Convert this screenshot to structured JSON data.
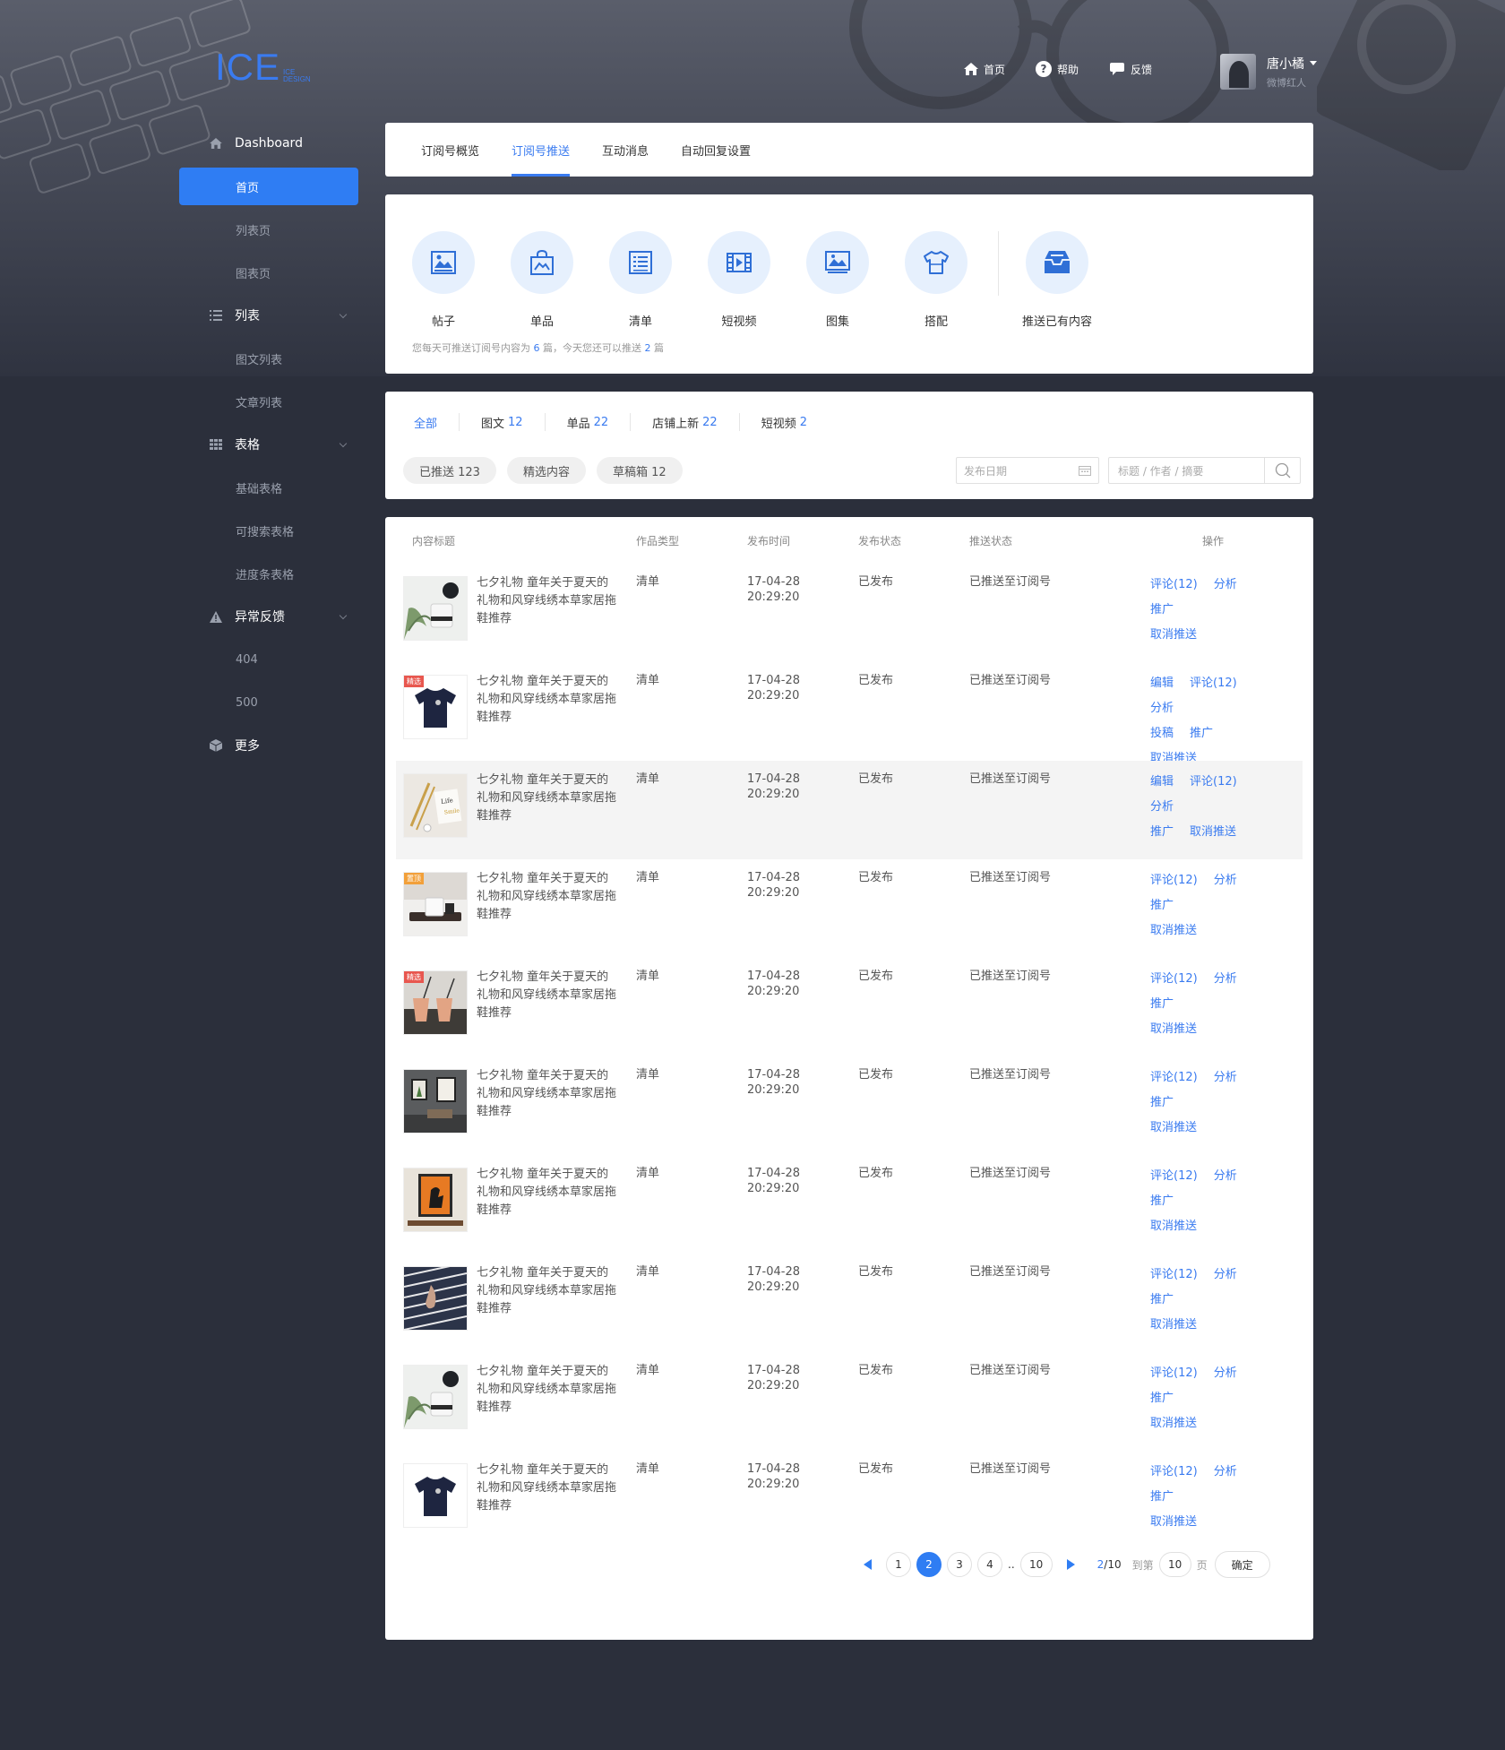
{
  "header": {
    "logo_main": "ICE",
    "logo_sub1": "ICE",
    "logo_sub2": "DESIGN",
    "nav": [
      {
        "label": "首页",
        "icon": "home-icon"
      },
      {
        "label": "帮助",
        "icon": "help-icon"
      },
      {
        "label": "反馈",
        "icon": "chat-icon"
      }
    ],
    "user": {
      "name": "唐小橘",
      "role": "微博红人"
    }
  },
  "sidebar": {
    "dashboard": "Dashboard",
    "dashboard_items": [
      "首页",
      "列表页",
      "图表页"
    ],
    "list": "列表",
    "list_items": [
      "图文列表",
      "文章列表"
    ],
    "table": "表格",
    "table_items": [
      "基础表格",
      "可搜索表格",
      "进度条表格"
    ],
    "error": "异常反馈",
    "error_items": [
      "404",
      "500"
    ],
    "more": "更多"
  },
  "tabs": [
    "订阅号概览",
    "订阅号推送",
    "互动消息",
    "自动回复设置"
  ],
  "active_tab": "订阅号推送",
  "push": {
    "items": [
      {
        "label": "帖子",
        "icon": "image-post-icon"
      },
      {
        "label": "单品",
        "icon": "shopping-bag-icon"
      },
      {
        "label": "清单",
        "icon": "list-icon"
      },
      {
        "label": "短视频",
        "icon": "video-icon"
      },
      {
        "label": "图集",
        "icon": "gallery-icon"
      },
      {
        "label": "搭配",
        "icon": "tshirt-icon"
      }
    ],
    "existing": {
      "label": "推送已有内容",
      "icon": "inbox-icon"
    },
    "note_pre": "您每天可推送订阅号内容为",
    "note_n1": "6",
    "note_mid": "篇，今天您还可以推送",
    "note_n2": "2",
    "note_post": "篇"
  },
  "filters": {
    "tabs": [
      {
        "label": "全部",
        "count": ""
      },
      {
        "label": "图文",
        "count": "12"
      },
      {
        "label": "单品",
        "count": "22"
      },
      {
        "label": "店铺上新",
        "count": "22"
      },
      {
        "label": "短视频",
        "count": "2"
      }
    ],
    "pills": [
      "已推送 123",
      "精选内容",
      "草稿箱 12"
    ],
    "date_placeholder": "发布日期",
    "search_placeholder": "标题 / 作者 / 摘要"
  },
  "table": {
    "headers": [
      "内容标题",
      "作品类型",
      "发布时间",
      "发布状态",
      "推送状态",
      "操作"
    ],
    "rows": [
      {
        "title": "七夕礼物 童年关于夏天的礼物和风穿线绣本草家居拖鞋推荐",
        "type": "清单",
        "date": "17-04-28",
        "time": "20:29:20",
        "status": "已发布",
        "push": "已推送至订阅号",
        "badge": "",
        "thumb": "candle",
        "ops": [
          [
            "评论(12)",
            "分析",
            "推广"
          ],
          [
            "取消推送"
          ]
        ]
      },
      {
        "title": "七夕礼物 童年关于夏天的礼物和风穿线绣本草家居拖鞋推荐",
        "type": "清单",
        "date": "17-04-28",
        "time": "20:29:20",
        "status": "已发布",
        "push": "已推送至订阅号",
        "badge": "精选",
        "badge_color": "red",
        "thumb": "tshirt",
        "ops": [
          [
            "编辑",
            "评论(12)",
            "分析"
          ],
          [
            "投稿",
            "推广",
            "取消推送"
          ]
        ]
      },
      {
        "title": "七夕礼物 童年关于夏天的礼物和风穿线绣本草家居拖鞋推荐",
        "type": "清单",
        "date": "17-04-28",
        "time": "20:29:20",
        "status": "已发布",
        "push": "已推送至订阅号",
        "badge": "",
        "thumb": "card",
        "ops": [
          [
            "编辑",
            "评论(12)",
            "分析"
          ],
          [
            "推广",
            "取消推送"
          ]
        ]
      },
      {
        "title": "七夕礼物 童年关于夏天的礼物和风穿线绣本草家居拖鞋推荐",
        "type": "清单",
        "date": "17-04-28",
        "time": "20:29:20",
        "status": "已发布",
        "push": "已推送至订阅号",
        "badge": "置顶",
        "badge_color": "orange",
        "thumb": "tray",
        "ops": [
          [
            "评论(12)",
            "分析",
            "推广"
          ],
          [
            "取消推送"
          ]
        ]
      },
      {
        "title": "七夕礼物 童年关于夏天的礼物和风穿线绣本草家居拖鞋推荐",
        "type": "清单",
        "date": "17-04-28",
        "time": "20:29:20",
        "status": "已发布",
        "push": "已推送至订阅号",
        "badge": "精选",
        "badge_color": "red",
        "thumb": "cups",
        "ops": [
          [
            "评论(12)",
            "分析",
            "推广"
          ],
          [
            "取消推送"
          ]
        ]
      },
      {
        "title": "七夕礼物 童年关于夏天的礼物和风穿线绣本草家居拖鞋推荐",
        "type": "清单",
        "date": "17-04-28",
        "time": "20:29:20",
        "status": "已发布",
        "push": "已推送至订阅号",
        "badge": "",
        "thumb": "frames",
        "ops": [
          [
            "评论(12)",
            "分析",
            "推广"
          ],
          [
            "取消推送"
          ]
        ]
      },
      {
        "title": "七夕礼物 童年关于夏天的礼物和风穿线绣本草家居拖鞋推荐",
        "type": "清单",
        "date": "17-04-28",
        "time": "20:29:20",
        "status": "已发布",
        "push": "已推送至订阅号",
        "badge": "",
        "thumb": "poster",
        "ops": [
          [
            "评论(12)",
            "分析",
            "推广"
          ],
          [
            "取消推送"
          ]
        ]
      },
      {
        "title": "七夕礼物 童年关于夏天的礼物和风穿线绣本草家居拖鞋推荐",
        "type": "清单",
        "date": "17-04-28",
        "time": "20:29:20",
        "status": "已发布",
        "push": "已推送至订阅号",
        "badge": "",
        "thumb": "fabric",
        "ops": [
          [
            "评论(12)",
            "分析",
            "推广"
          ],
          [
            "取消推送"
          ]
        ]
      },
      {
        "title": "七夕礼物 童年关于夏天的礼物和风穿线绣本草家居拖鞋推荐",
        "type": "清单",
        "date": "17-04-28",
        "time": "20:29:20",
        "status": "已发布",
        "push": "已推送至订阅号",
        "badge": "",
        "thumb": "candle",
        "ops": [
          [
            "评论(12)",
            "分析",
            "推广"
          ],
          [
            "取消推送"
          ]
        ]
      },
      {
        "title": "七夕礼物 童年关于夏天的礼物和风穿线绣本草家居拖鞋推荐",
        "type": "清单",
        "date": "17-04-28",
        "time": "20:29:20",
        "status": "已发布",
        "push": "已推送至订阅号",
        "badge": "",
        "thumb": "tshirt",
        "ops": [
          [
            "评论(12)",
            "分析",
            "推广"
          ],
          [
            "取消推送"
          ]
        ]
      }
    ]
  },
  "pagination": {
    "pages": [
      "1",
      "2",
      "3",
      "4"
    ],
    "active": "2",
    "ellipsis": "..",
    "last": "10",
    "current": "2",
    "total": "/10",
    "goto_label": "到第",
    "goto_value": "10",
    "page_label": "页",
    "confirm": "确定"
  },
  "colors": {
    "accent": "#2f7df3",
    "sidebar_bg": "#2b2f3b"
  }
}
